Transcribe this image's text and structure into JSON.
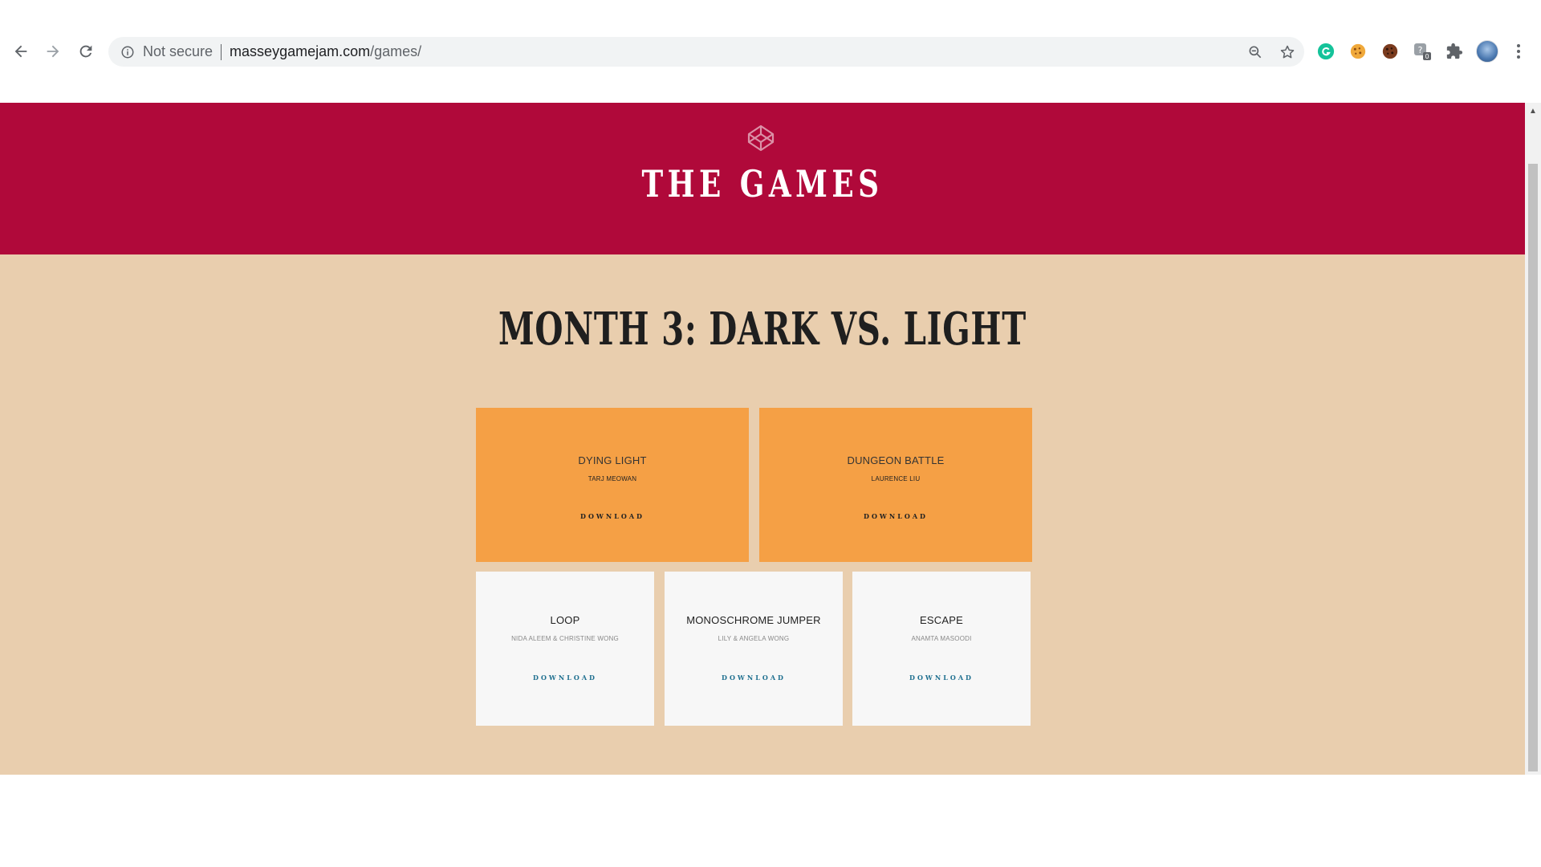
{
  "browser": {
    "security_label": "Not secure",
    "url_domain": "masseygamejam.com",
    "url_path": "/games/",
    "icons": {
      "back": "back-arrow-icon",
      "forward": "forward-arrow-icon",
      "reload": "reload-icon",
      "info": "info-icon",
      "zoom": "zoom-out-icon",
      "star": "star-icon",
      "extensions": [
        "grammarly-icon",
        "cookie-icon",
        "cookie-editor-icon",
        "privacy-badge-icon",
        "puzzle-icon"
      ],
      "menu": "kebab-menu-icon"
    },
    "privacy_badge_count": "0"
  },
  "hero": {
    "title": "THE GAMES",
    "icon": "codepen-icon",
    "background": "#b0093a"
  },
  "section": {
    "title": "MONTH 3: DARK VS. LIGHT",
    "background": "#e9ceae",
    "games": [
      {
        "title": "DYING LIGHT",
        "author": "TARJ MEOWAN",
        "download": "DOWNLOAD",
        "featured": true
      },
      {
        "title": "DUNGEON BATTLE",
        "author": "LAURENCE LIU",
        "download": "DOWNLOAD",
        "featured": true
      },
      {
        "title": "LOOP",
        "author": "NIDA ALEEM & CHRISTINE WONG",
        "download": "DOWNLOAD",
        "featured": false
      },
      {
        "title": "MONOSCHROME JUMPER",
        "author": "LILY & ANGELA WONG",
        "download": "DOWNLOAD",
        "featured": false
      },
      {
        "title": "ESCAPE",
        "author": "ANAMTA MASOODI",
        "download": "DOWNLOAD",
        "featured": false
      }
    ]
  },
  "colors": {
    "featured_card": "#f5a045",
    "plain_card": "#f7f7f7",
    "download_link": "#1e6f8f"
  }
}
